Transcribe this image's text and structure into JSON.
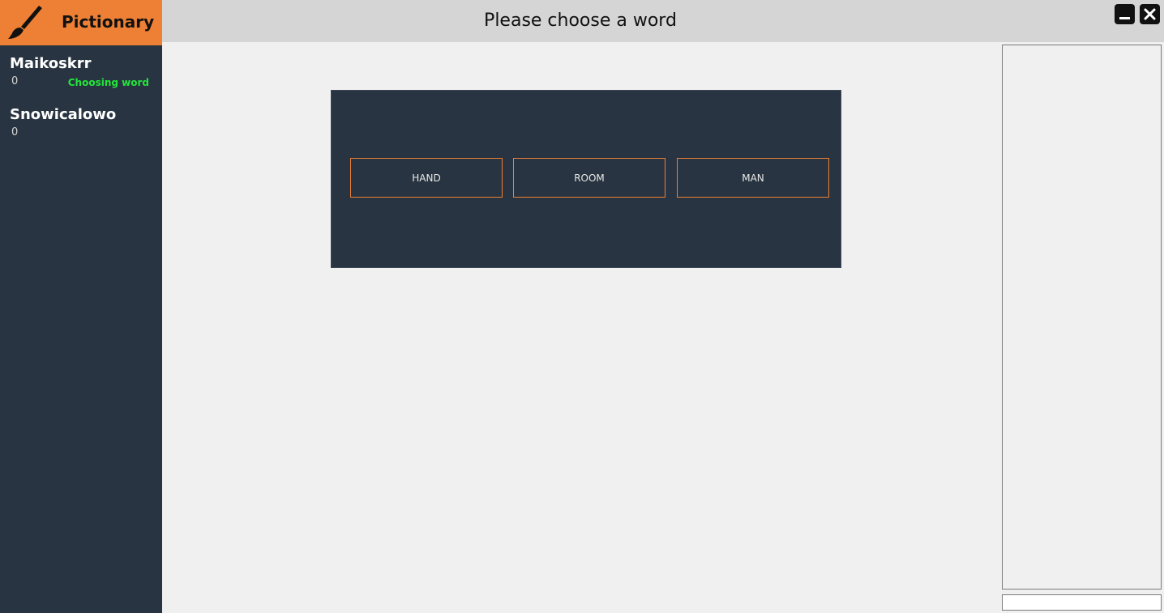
{
  "app": {
    "title": "Pictionary"
  },
  "header": {
    "prompt": "Please choose a word"
  },
  "players": [
    {
      "name": "Maikoskrr",
      "score": "0",
      "status": "Choosing word"
    },
    {
      "name": "Snowicalowo",
      "score": "0",
      "status": ""
    }
  ],
  "words": [
    "HAND",
    "ROOM",
    "MAN"
  ],
  "window_controls": {
    "minimize_icon": "minimize-icon",
    "close_icon": "close-icon"
  },
  "colors": {
    "brand_orange": "#ed8034",
    "sidebar_bg": "#283441",
    "status_green": "#22e63a",
    "topbar_bg": "#d5d5d5"
  },
  "chat": {
    "input_value": ""
  }
}
